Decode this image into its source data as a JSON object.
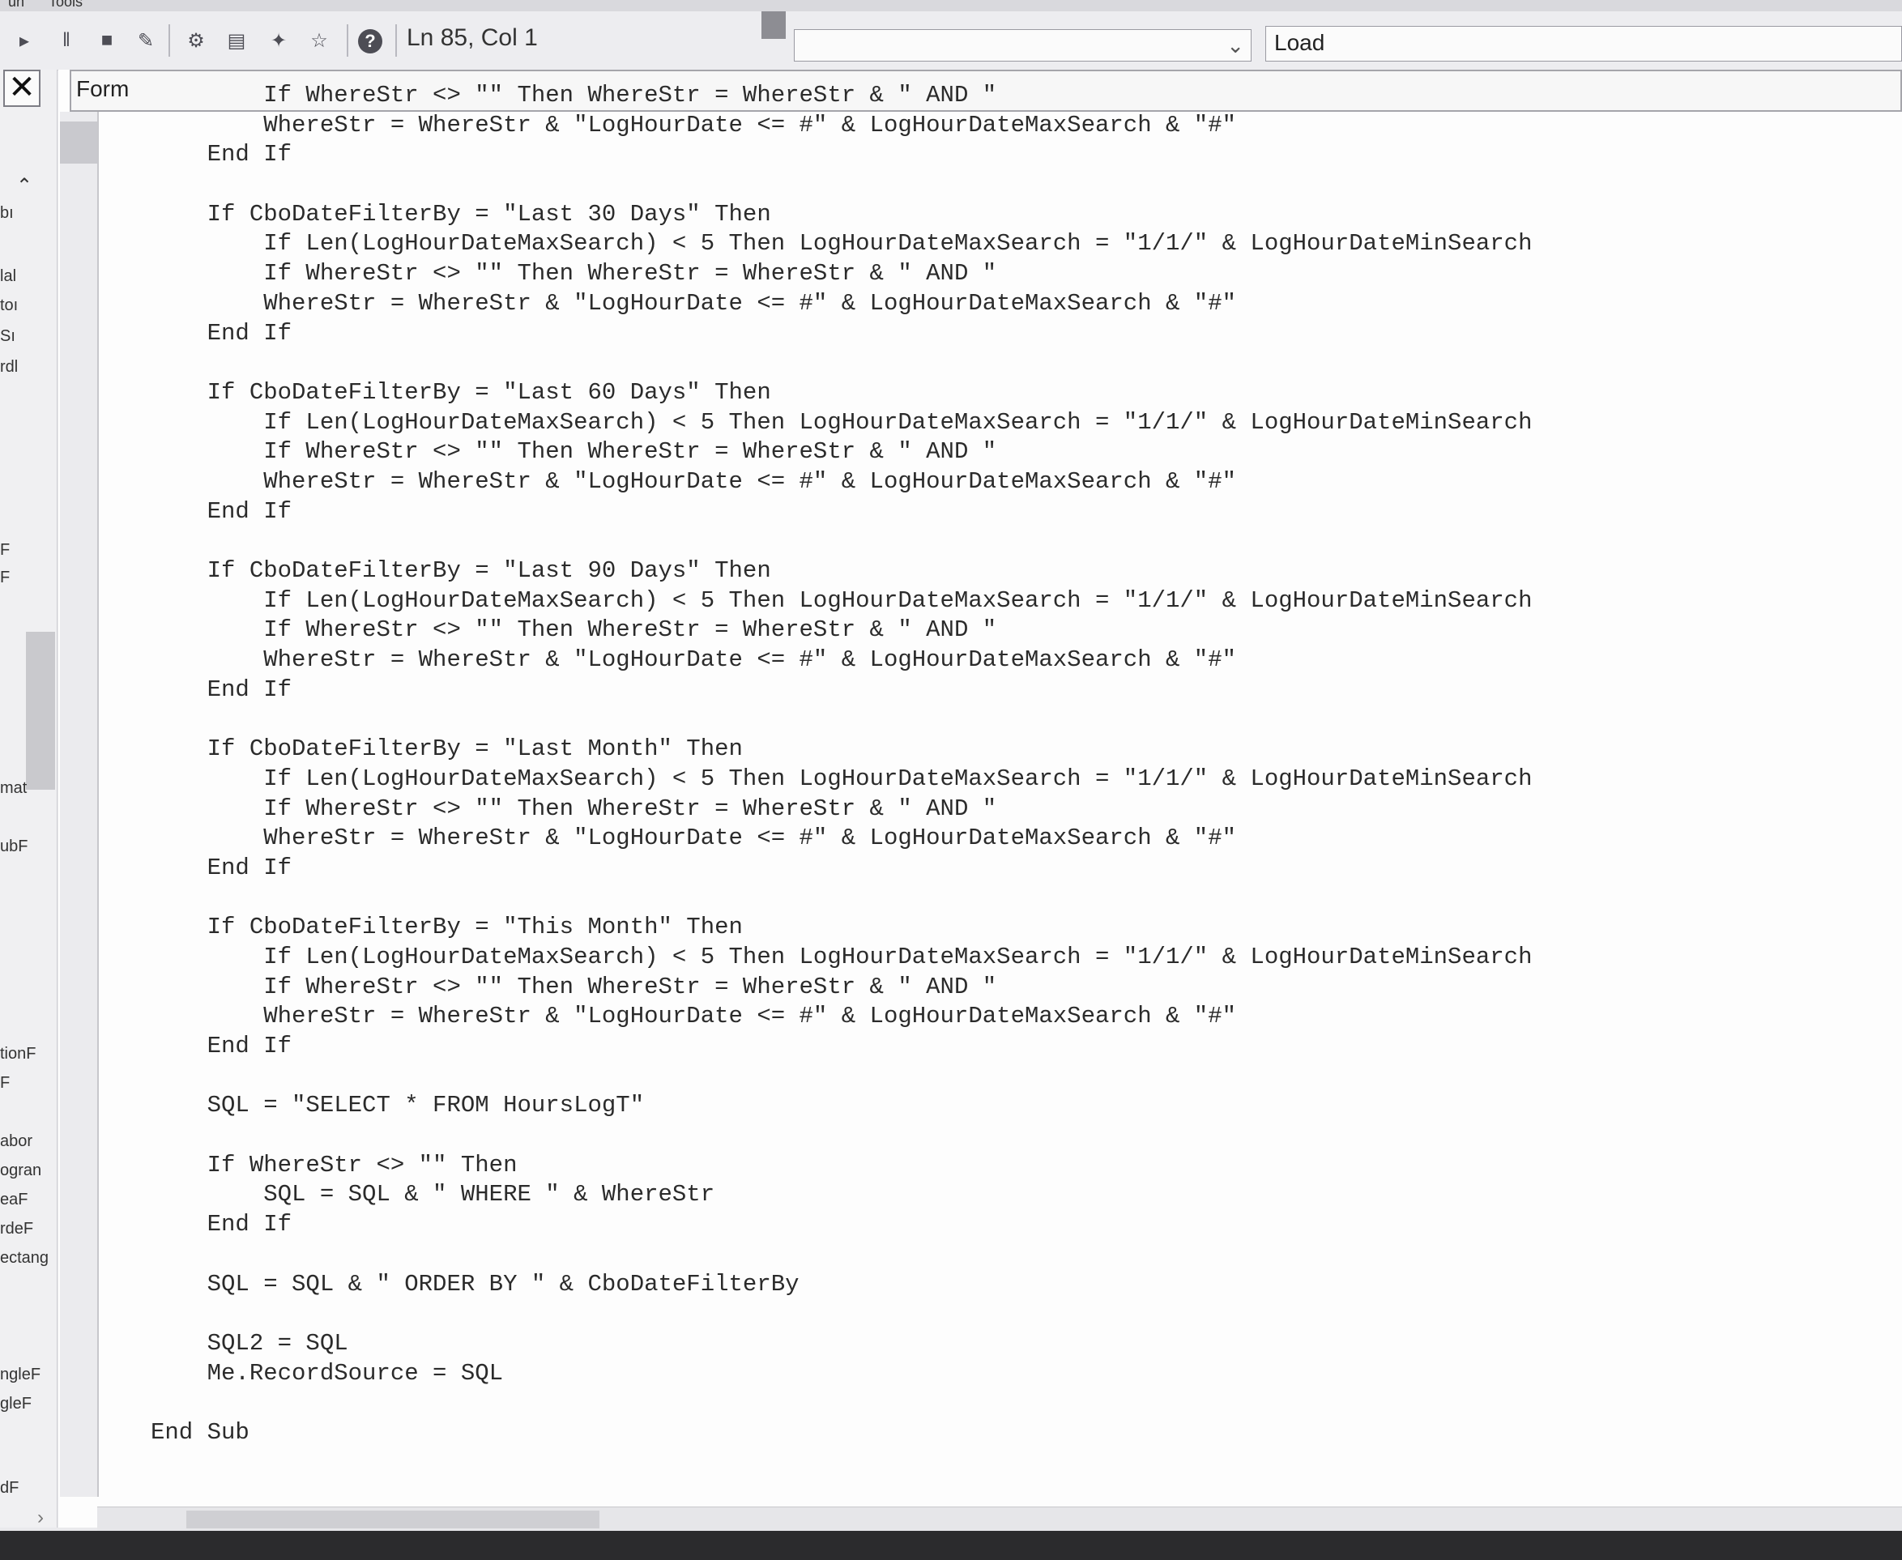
{
  "menu": {
    "partial_items": [
      "un",
      "Tools"
    ]
  },
  "toolbar": {
    "status": "Ln 85, Col 1",
    "icons": [
      "run-icon",
      "pause-icon",
      "stop-icon",
      "design-mode-icon",
      "project-explorer-icon",
      "properties-icon",
      "object-browser-icon",
      "toolbox-icon",
      "help-icon"
    ]
  },
  "object_combo": {
    "value": ""
  },
  "procedure_combo": {
    "value": "Load"
  },
  "left_panel": {
    "labels": [
      "bı",
      "lal",
      "toı",
      "Sı",
      "rdl",
      "F",
      "F",
      "mat",
      "ubF",
      "tionF",
      "F",
      "abor",
      "ogran",
      "eaF",
      "rdeF",
      "ectang",
      "",
      "ngleF",
      "gleF",
      "dF"
    ]
  },
  "code_window": {
    "object_label": "Form",
    "lines": [
      "        If WhereStr <> \"\" Then WhereStr = WhereStr & \" AND \"",
      "        WhereStr = WhereStr & \"LogHourDate <= #\" & LogHourDateMaxSearch & \"#\"",
      "    End If",
      "",
      "    If CboDateFilterBy = \"Last 30 Days\" Then",
      "        If Len(LogHourDateMaxSearch) < 5 Then LogHourDateMaxSearch = \"1/1/\" & LogHourDateMinSearch",
      "        If WhereStr <> \"\" Then WhereStr = WhereStr & \" AND \"",
      "        WhereStr = WhereStr & \"LogHourDate <= #\" & LogHourDateMaxSearch & \"#\"",
      "    End If",
      "",
      "    If CboDateFilterBy = \"Last 60 Days\" Then",
      "        If Len(LogHourDateMaxSearch) < 5 Then LogHourDateMaxSearch = \"1/1/\" & LogHourDateMinSearch",
      "        If WhereStr <> \"\" Then WhereStr = WhereStr & \" AND \"",
      "        WhereStr = WhereStr & \"LogHourDate <= #\" & LogHourDateMaxSearch & \"#\"",
      "    End If",
      "",
      "    If CboDateFilterBy = \"Last 90 Days\" Then",
      "        If Len(LogHourDateMaxSearch) < 5 Then LogHourDateMaxSearch = \"1/1/\" & LogHourDateMinSearch",
      "        If WhereStr <> \"\" Then WhereStr = WhereStr & \" AND \"",
      "        WhereStr = WhereStr & \"LogHourDate <= #\" & LogHourDateMaxSearch & \"#\"",
      "    End If",
      "",
      "    If CboDateFilterBy = \"Last Month\" Then",
      "        If Len(LogHourDateMaxSearch) < 5 Then LogHourDateMaxSearch = \"1/1/\" & LogHourDateMinSearch",
      "        If WhereStr <> \"\" Then WhereStr = WhereStr & \" AND \"",
      "        WhereStr = WhereStr & \"LogHourDate <= #\" & LogHourDateMaxSearch & \"#\"",
      "    End If",
      "",
      "    If CboDateFilterBy = \"This Month\" Then",
      "        If Len(LogHourDateMaxSearch) < 5 Then LogHourDateMaxSearch = \"1/1/\" & LogHourDateMinSearch",
      "        If WhereStr <> \"\" Then WhereStr = WhereStr & \" AND \"",
      "        WhereStr = WhereStr & \"LogHourDate <= #\" & LogHourDateMaxSearch & \"#\"",
      "    End If",
      "",
      "    SQL = \"SELECT * FROM HoursLogT\"",
      "",
      "    If WhereStr <> \"\" Then",
      "        SQL = SQL & \" WHERE \" & WhereStr",
      "    End If",
      "",
      "    SQL = SQL & \" ORDER BY \" & CboDateFilterBy",
      "",
      "    SQL2 = SQL",
      "    Me.RecordSource = SQL",
      "",
      "End Sub"
    ]
  }
}
